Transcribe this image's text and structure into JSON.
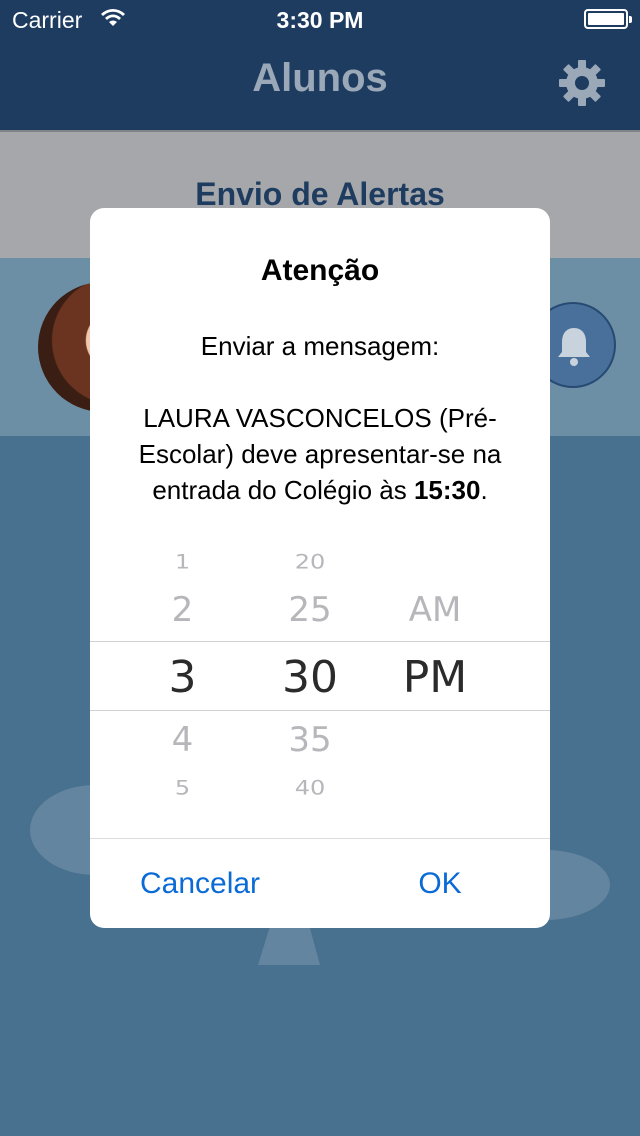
{
  "status_bar": {
    "carrier": "Carrier",
    "time": "3:30 PM"
  },
  "nav": {
    "title": "Alunos",
    "settings_icon": "gear-icon"
  },
  "subheader": {
    "title": "Envio de Alertas"
  },
  "student": {
    "bell_icon": "bell-icon"
  },
  "alert": {
    "title": "Atenção",
    "message_intro": "Enviar a mensagem:",
    "message_body": "LAURA VASCONCELOS (Pré-Escolar) deve apresentar-se na entrada do Colégio às ",
    "message_time": "15:30",
    "message_end": ".",
    "picker": {
      "hours": [
        "1",
        "2",
        "3",
        "4",
        "5"
      ],
      "minutes": [
        "20",
        "25",
        "30",
        "35",
        "40"
      ],
      "periods": [
        "AM",
        "PM"
      ],
      "selected_hour": "3",
      "selected_minute": "30",
      "selected_period": "PM"
    },
    "cancel_label": "Cancelar",
    "ok_label": "OK"
  },
  "colors": {
    "nav_bg": "#1e3c60",
    "background": "#48708f",
    "accent": "#0a6bd6"
  }
}
